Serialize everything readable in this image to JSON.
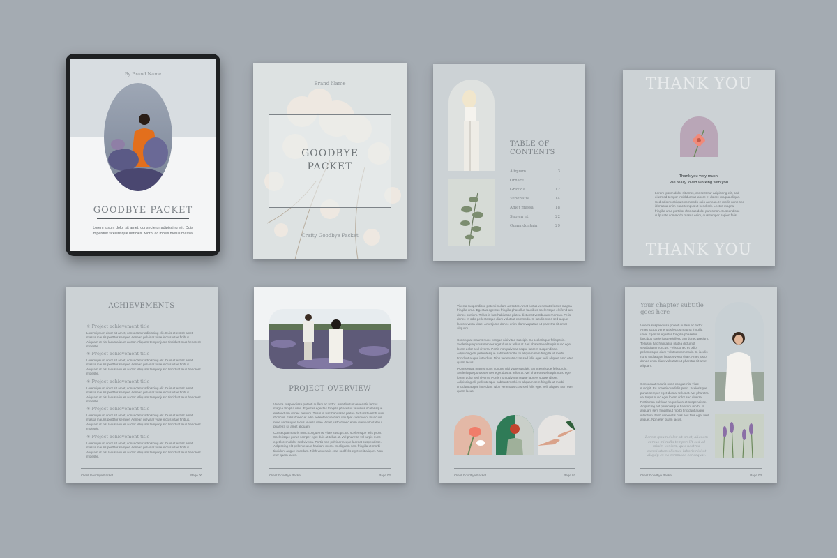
{
  "tablet": {
    "brand": "By Brand Name",
    "title": "GOODBYE PACKET",
    "body": "Lorem ipsum dolor sit amet, consectetur adipiscing elit. Duis imperdiet scelerisque ultricies. Morbi ac mollis metus massa."
  },
  "cover": {
    "brand": "Brand Name",
    "title_line1": "GOODBYE",
    "title_line2": "PACKET",
    "footer": "Crafty Goodbye Packet"
  },
  "toc": {
    "title_line1": "TABLE OF",
    "title_line2": "CONTENTS",
    "items": [
      {
        "label": "Aliquam",
        "page": "3"
      },
      {
        "label": "Ornare",
        "page": "7"
      },
      {
        "label": "Gravida",
        "page": "12"
      },
      {
        "label": "Venenatis",
        "page": "14"
      },
      {
        "label": "Amet massa",
        "page": "18"
      },
      {
        "label": "Sapien et",
        "page": "22"
      },
      {
        "label": "Quam dontain",
        "page": "29"
      }
    ]
  },
  "thanks": {
    "top": "THANK YOU",
    "line1": "Thank you very much!",
    "line2": "We really loved working with you",
    "body": "Lorem ipsum dolor sit amet, consectetur adipiscing elit, sed eiusmod tempor incididunt ut labore et dolore magna aliqua. Sed odio morbi quis commodo odio aenean. In mollis nunc sed id massa enim nunc tempus ut hendrerit. Lectus magna fringilla urna porttitor rhoncus dolor purus non. Suspendisse vulputate commodo massa enim, quis tempor sapien felis.",
    "bottom": "THANK YOU"
  },
  "achievements": {
    "title": "ACHIEVEMENTS",
    "items": [
      {
        "title": "Project achievement title",
        "body": "Lorem ipsum dolor sit amet, consectetur adipiscing elit. Duis et est sit amet massa mauris porttitor semper. Aenean pulvinar vitae lectus vitae finibus. Aliquam ut nisi lacus aliquet auctor. Aliquam tempor justo tincidunt mus hendrerit molestie."
      },
      {
        "title": "Project achievement title",
        "body": "Lorem ipsum dolor sit amet, consectetur adipiscing elit. Duis et est sit amet massa mauris porttitor semper. Aenean pulvinar vitae lectus vitae finibus. Aliquam ut nisi lacus aliquet auctor. Aliquam tempor justo tincidunt mus hendrerit molestie."
      },
      {
        "title": "Project achievement title",
        "body": "Lorem ipsum dolor sit amet, consectetur adipiscing elit. Duis et est sit amet massa mauris porttitor semper. Aenean pulvinar vitae lectus vitae finibus. Aliquam ut nisi lacus aliquet auctor. Aliquam tempor justo tincidunt mus hendrerit molestie."
      },
      {
        "title": "Project achievement title",
        "body": "Lorem ipsum dolor sit amet, consectetur adipiscing elit. Duis et est sit amet massa mauris porttitor semper. Aenean pulvinar vitae lectus vitae finibus. Aliquam ut nisi lacus aliquet auctor. Aliquam tempor justo tincidunt mus hendrerit molestie."
      },
      {
        "title": "Project achievement title",
        "body": "Lorem ipsum dolor sit amet, consectetur adipiscing elit. Duis et est sit amet massa mauris porttitor semper. Aenean pulvinar vitae lectus vitae finibus. Aliquam ut nisi lacus aliquet auctor. Aliquam tempor justo tincidunt mus hendrerit molestie."
      }
    ],
    "footer_left": "Client Goodbye Packet",
    "footer_right": "Page 00"
  },
  "overview": {
    "title": "PROJECT OVERVIEW",
    "para1": "Viverra suspendisse potenti nullam ac tortor. Amet luctus venenatis lectus magna fringilla urna. Egestas egestas fringilla phasellus faucibus scelerisque eleifend am donec pretium. Tellus in hac habitasse platea dictumst vestibulum rhoncus. Felis donec et odio pellentesque diam volutpat commodo. In iaculis nunc sed augue lacus viverra vitae. Amet justo donec enim diam vulputate ut pharetra sit amet aliquam.",
    "para2": "Consequat mauris nunc congue nisi vitae suscipit. Eu scelerisque felis proin. Scelerisque purus semper eget duis at tellus at. Vel pharetra vel turpis nunc eget lorem dolor sed viverra. Portis non pulvinar neque laoreet suspendisse. Adipiscing elit pellentesque habitant morbi. In aliquam sem fringilla ut morbi tincidunt augue interdum. Nibh venenatis cras sed felis eget velit aliquet. Non eter quam lacus.",
    "footer_left": "Client Goodbye Packet",
    "footer_right": "Page 02"
  },
  "text_page": {
    "para1": "Viverra suspendisse potenti nullam ac tortor. Amet luctus venenatis lectus magna fringilla urna. Egestas egestas fringilla phasellus faucibus scelerisque eleifend am donec pretium. Tellus in hac habitasse platea dictumst vestibulum rhoncus. Felis donec et odio pellentesque diam volutpat commodo. In iaculis nunc sed augue lacus viverra vitae. Amet justo donec enim diam vulputate ut pharetra sit amet aliquam.",
    "para2": "Consequat mauris nunc congue nisi vitae suscipit. Eu scelerisque felis proin. Scelerisque purus semper eget duis at tellus at. Vel pharetra vel turpis nunc eget lorem dolor sed viverra. Portis non pulvinar neque laoreet suspendisse. Adipiscing elit pellentesque habitant morbi. In aliquam sem fringilla ut morbi tincidunt augue interdum. Nibh venenatis cras sed felis eget velit aliquet. Non eter quam lacus.",
    "para3": "PConsequat mauris nunc congue nisi vitae suscipit. Eu scelerisque felis proin. Scelerisque purus semper eget duis at tellus at. Vel pharetra vel turpis nunc eget lorem dolor sed viverra. Portis non pulvinar neque laoreet suspendisse. Adipiscing elit pellentesque habitant morbi. In aliquam sem fringilla ut morbi tincidunt augue interdum. Nibh venenatis cras sed felis eget velit aliquet. Non eter quam lacus.",
    "footer_left": "Client Goodbye Packet",
    "footer_right": "Page 02"
  },
  "chapter": {
    "title_line1": "Your chapter subtitle",
    "title_line2": "goes here",
    "para1": "Viverra suspendisse potenti nullam ac tortor. Amet luctus venenatis lectus magna fringilla urna. Egestas egestas fringilla phasellus faucibus scelerisque eleifend am donec pretium. Tellus in hac habitasse platea dictumst vestibulum rhoncus. Felis donec et odio pellentesque diam volutpat commodo. In iaculis nunc sed augue lacus viverra vitae. Amet justo donec enim diam vulputate ut pharetra sit amet aliquam.",
    "para2": "Consequat mauris nunc congue nisi vitae suscipit. Eu scelerisque felis proin. Scelerisque purus semper eget duis at tellus at. Vel pharetra vel turpis nunc eget lorem dolor sed viverra. Portis non pulvinar neque laoreet suspendisse. Adipiscing elit pellentesque habitant morbi. In aliquam sem fringilla ut morbi tincidunt augue interdum. Nibh venenatis cras sed felis eget velit aliquet. Non eter quam lacus.",
    "quote": "Lorem ipsum dolor sit amet, aliquam cursus mi nulla tempor. Ut sed ad minim veniam, quis nostrud exercitation ullamco laboris nisi ut aliquip ex ea commodo consequat.",
    "footer_left": "Client Goodbye Packet",
    "footer_right": "Page 03"
  },
  "colors": {
    "background": "#a4abb2",
    "page": "#ccd2d5",
    "text": "#6f7478",
    "heading": "#8a9094"
  }
}
